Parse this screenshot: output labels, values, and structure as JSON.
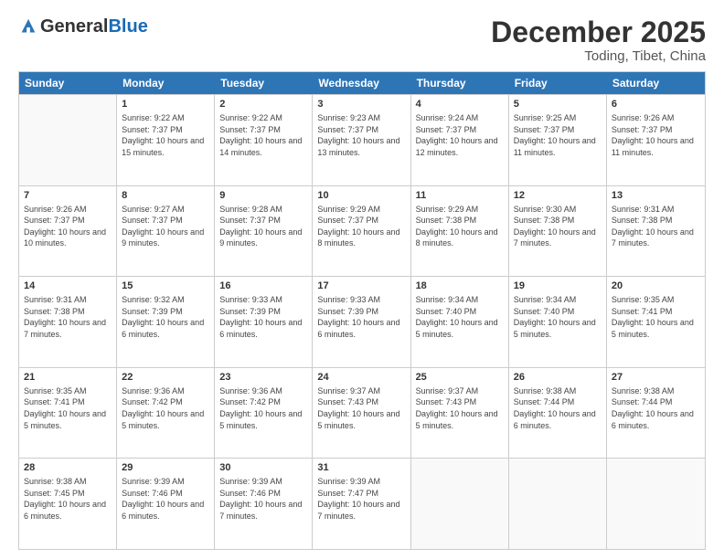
{
  "header": {
    "logo": {
      "general": "General",
      "blue": "Blue"
    },
    "title": "December 2025",
    "location": "Toding, Tibet, China"
  },
  "weekdays": [
    "Sunday",
    "Monday",
    "Tuesday",
    "Wednesday",
    "Thursday",
    "Friday",
    "Saturday"
  ],
  "rows": [
    [
      {
        "day": "",
        "sunrise": "",
        "sunset": "",
        "daylight": "",
        "empty": true
      },
      {
        "day": "1",
        "sunrise": "9:22 AM",
        "sunset": "7:37 PM",
        "daylight": "10 hours and 15 minutes."
      },
      {
        "day": "2",
        "sunrise": "9:22 AM",
        "sunset": "7:37 PM",
        "daylight": "10 hours and 14 minutes."
      },
      {
        "day": "3",
        "sunrise": "9:23 AM",
        "sunset": "7:37 PM",
        "daylight": "10 hours and 13 minutes."
      },
      {
        "day": "4",
        "sunrise": "9:24 AM",
        "sunset": "7:37 PM",
        "daylight": "10 hours and 12 minutes."
      },
      {
        "day": "5",
        "sunrise": "9:25 AM",
        "sunset": "7:37 PM",
        "daylight": "10 hours and 11 minutes."
      },
      {
        "day": "6",
        "sunrise": "9:26 AM",
        "sunset": "7:37 PM",
        "daylight": "10 hours and 11 minutes."
      }
    ],
    [
      {
        "day": "7",
        "sunrise": "9:26 AM",
        "sunset": "7:37 PM",
        "daylight": "10 hours and 10 minutes."
      },
      {
        "day": "8",
        "sunrise": "9:27 AM",
        "sunset": "7:37 PM",
        "daylight": "10 hours and 9 minutes."
      },
      {
        "day": "9",
        "sunrise": "9:28 AM",
        "sunset": "7:37 PM",
        "daylight": "10 hours and 9 minutes."
      },
      {
        "day": "10",
        "sunrise": "9:29 AM",
        "sunset": "7:37 PM",
        "daylight": "10 hours and 8 minutes."
      },
      {
        "day": "11",
        "sunrise": "9:29 AM",
        "sunset": "7:38 PM",
        "daylight": "10 hours and 8 minutes."
      },
      {
        "day": "12",
        "sunrise": "9:30 AM",
        "sunset": "7:38 PM",
        "daylight": "10 hours and 7 minutes."
      },
      {
        "day": "13",
        "sunrise": "9:31 AM",
        "sunset": "7:38 PM",
        "daylight": "10 hours and 7 minutes."
      }
    ],
    [
      {
        "day": "14",
        "sunrise": "9:31 AM",
        "sunset": "7:38 PM",
        "daylight": "10 hours and 7 minutes."
      },
      {
        "day": "15",
        "sunrise": "9:32 AM",
        "sunset": "7:39 PM",
        "daylight": "10 hours and 6 minutes."
      },
      {
        "day": "16",
        "sunrise": "9:33 AM",
        "sunset": "7:39 PM",
        "daylight": "10 hours and 6 minutes."
      },
      {
        "day": "17",
        "sunrise": "9:33 AM",
        "sunset": "7:39 PM",
        "daylight": "10 hours and 6 minutes."
      },
      {
        "day": "18",
        "sunrise": "9:34 AM",
        "sunset": "7:40 PM",
        "daylight": "10 hours and 5 minutes."
      },
      {
        "day": "19",
        "sunrise": "9:34 AM",
        "sunset": "7:40 PM",
        "daylight": "10 hours and 5 minutes."
      },
      {
        "day": "20",
        "sunrise": "9:35 AM",
        "sunset": "7:41 PM",
        "daylight": "10 hours and 5 minutes."
      }
    ],
    [
      {
        "day": "21",
        "sunrise": "9:35 AM",
        "sunset": "7:41 PM",
        "daylight": "10 hours and 5 minutes."
      },
      {
        "day": "22",
        "sunrise": "9:36 AM",
        "sunset": "7:42 PM",
        "daylight": "10 hours and 5 minutes."
      },
      {
        "day": "23",
        "sunrise": "9:36 AM",
        "sunset": "7:42 PM",
        "daylight": "10 hours and 5 minutes."
      },
      {
        "day": "24",
        "sunrise": "9:37 AM",
        "sunset": "7:43 PM",
        "daylight": "10 hours and 5 minutes."
      },
      {
        "day": "25",
        "sunrise": "9:37 AM",
        "sunset": "7:43 PM",
        "daylight": "10 hours and 5 minutes."
      },
      {
        "day": "26",
        "sunrise": "9:38 AM",
        "sunset": "7:44 PM",
        "daylight": "10 hours and 6 minutes."
      },
      {
        "day": "27",
        "sunrise": "9:38 AM",
        "sunset": "7:44 PM",
        "daylight": "10 hours and 6 minutes."
      }
    ],
    [
      {
        "day": "28",
        "sunrise": "9:38 AM",
        "sunset": "7:45 PM",
        "daylight": "10 hours and 6 minutes."
      },
      {
        "day": "29",
        "sunrise": "9:39 AM",
        "sunset": "7:46 PM",
        "daylight": "10 hours and 6 minutes."
      },
      {
        "day": "30",
        "sunrise": "9:39 AM",
        "sunset": "7:46 PM",
        "daylight": "10 hours and 7 minutes."
      },
      {
        "day": "31",
        "sunrise": "9:39 AM",
        "sunset": "7:47 PM",
        "daylight": "10 hours and 7 minutes."
      },
      {
        "day": "",
        "sunrise": "",
        "sunset": "",
        "daylight": "",
        "empty": true
      },
      {
        "day": "",
        "sunrise": "",
        "sunset": "",
        "daylight": "",
        "empty": true
      },
      {
        "day": "",
        "sunrise": "",
        "sunset": "",
        "daylight": "",
        "empty": true
      }
    ]
  ]
}
